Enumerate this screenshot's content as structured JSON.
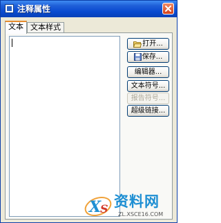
{
  "window": {
    "title": "注释属性",
    "icons": {
      "app": "app-icon",
      "close": "close-icon"
    }
  },
  "tabs": [
    {
      "label": "文本",
      "active": true
    },
    {
      "label": "文本样式",
      "active": false
    }
  ],
  "text_area": {
    "value": ""
  },
  "buttons": {
    "open": "打开...",
    "save": "保存...",
    "editor": "编辑器...",
    "text_symbol": "文本符号...",
    "text_symbol_disabled": "报告符号...",
    "hyperlink": "超级链接..."
  },
  "button_icons": {
    "open": "folder-open-icon",
    "save": "floppy-disk-icon"
  },
  "watermark": {
    "brand": "资料网",
    "url": "ZL.XSCE16.COM"
  },
  "colors": {
    "titlebar": "#0a4bd0",
    "tab_highlight": "#e68b2c",
    "close_button": "#d2421b",
    "watermark": "#1e8fd3"
  }
}
